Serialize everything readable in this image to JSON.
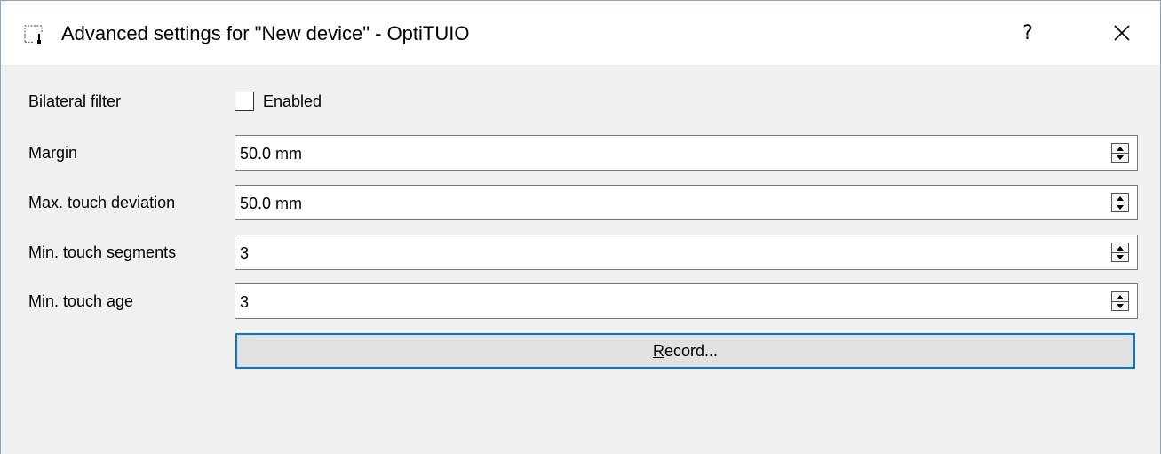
{
  "window": {
    "title": "Advanced settings for \"New device\" - OptiTUIO",
    "help_label": "?",
    "icons": {
      "app": "window-app-icon",
      "help": "help-icon",
      "close": "close-icon"
    }
  },
  "form": {
    "bilateral_filter": {
      "label": "Bilateral filter",
      "checkbox_label": "Enabled",
      "checked": false
    },
    "margin": {
      "label": "Margin",
      "value": "50.0 mm"
    },
    "max_touch_deviation": {
      "label": "Max. touch deviation",
      "value": "50.0 mm"
    },
    "min_touch_segments": {
      "label": "Min. touch segments",
      "value": "3"
    },
    "min_touch_age": {
      "label": "Min. touch age",
      "value": "3"
    }
  },
  "record_button": {
    "mnemonic": "R",
    "rest": "ecord..."
  },
  "colors": {
    "focus_accent": "#0078d7",
    "dialog_bg": "#f0f0f0",
    "titlebar_bg": "#ffffff"
  }
}
